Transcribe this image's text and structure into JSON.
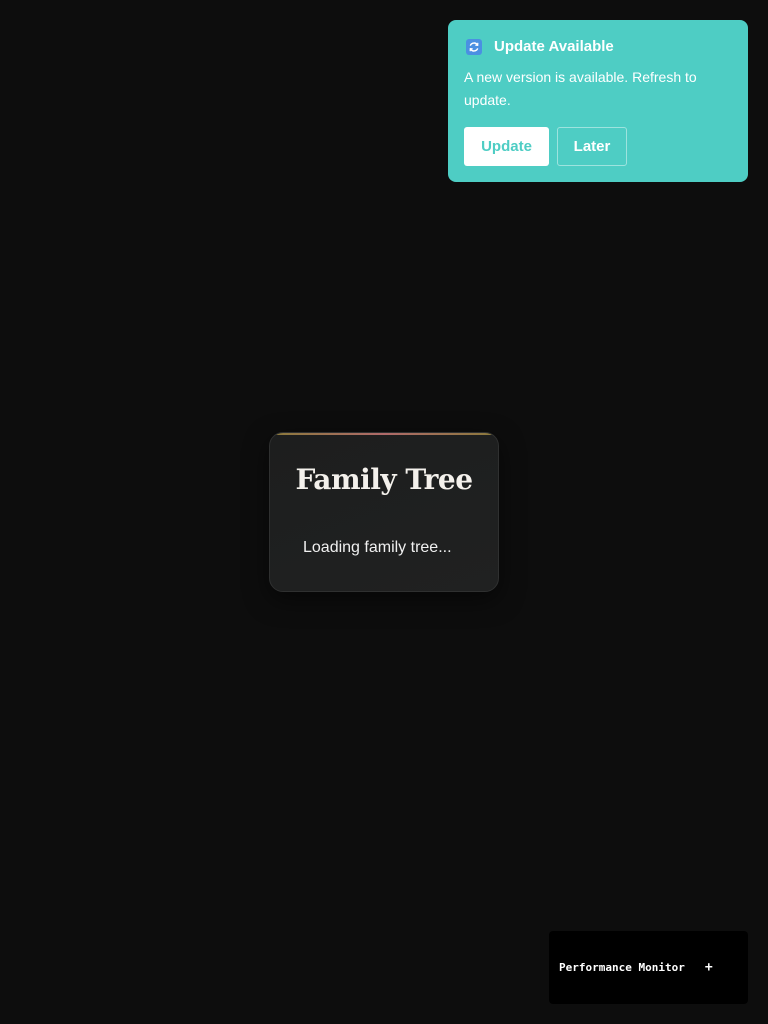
{
  "toast": {
    "icon": "refresh-icon",
    "title": "Update Available",
    "message": "A new version is available. Refresh to update.",
    "update_label": "Update",
    "later_label": "Later",
    "background_color": "#4ecdc4"
  },
  "loading_card": {
    "title": "Family Tree",
    "status_text": "Loading family tree..."
  },
  "perf_monitor": {
    "label": "Performance Monitor",
    "toggle_label": "+"
  }
}
